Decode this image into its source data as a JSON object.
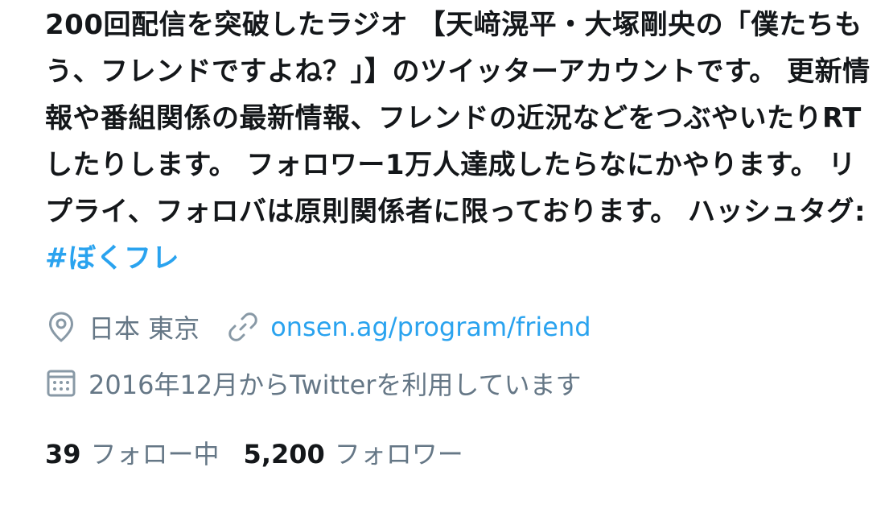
{
  "profile": {
    "bio_text": "200回配信を突破したラジオ 【天﨑滉平・大塚剛央の「僕たちもう、フレンドですよね？」】のツイッターアカウントです。 更新情報や番組関係の最新情報、フレンドの近況などをつぶやいたりRTしたりします。 フォロワー1万人達成したらなにかやります。 リプライ、フォロバは原則関係者に限っております。 ハッシュタグ: ",
    "hashtag": "#ぼくフレ",
    "location": "日本 東京",
    "website": "onsen.ag/program/friend",
    "joined": "2016年12月からTwitterを利用しています",
    "following_count": "39",
    "following_label": "フォロー中",
    "followers_count": "5,200",
    "followers_label": "フォロワー"
  },
  "icons": {
    "location": "location-pin-icon",
    "link": "link-icon",
    "calendar": "calendar-icon"
  },
  "colors": {
    "text": "#14171a",
    "secondary": "#657786",
    "accent": "#2aa3ef"
  }
}
